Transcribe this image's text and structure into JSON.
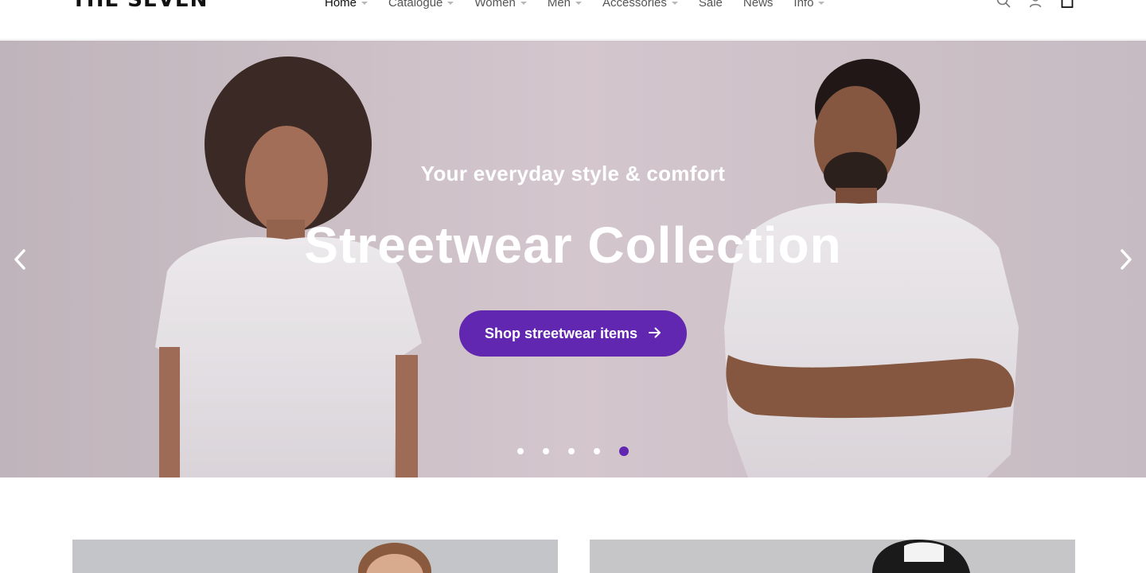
{
  "header": {
    "logo": "THE SEVEN",
    "nav": [
      {
        "label": "Home",
        "has_dropdown": true,
        "active": true
      },
      {
        "label": "Catalogue",
        "has_dropdown": true,
        "active": false
      },
      {
        "label": "Women",
        "has_dropdown": true,
        "active": false
      },
      {
        "label": "Men",
        "has_dropdown": true,
        "active": false
      },
      {
        "label": "Accessories",
        "has_dropdown": true,
        "active": false
      },
      {
        "label": "Sale",
        "has_dropdown": false,
        "active": false
      },
      {
        "label": "News",
        "has_dropdown": false,
        "active": false
      },
      {
        "label": "Info",
        "has_dropdown": true,
        "active": false
      }
    ],
    "icons": [
      "search-icon",
      "account-icon",
      "cart-icon"
    ]
  },
  "hero": {
    "subtitle": "Your everyday style & comfort",
    "title": "Streetwear Collection",
    "cta_label": "Shop streetwear items",
    "slides_total": 5,
    "active_slide": 5
  },
  "colors": {
    "accent": "#6227b0",
    "hero_bg": "#d8ccd1",
    "text_dark": "#111111",
    "nav_text": "#555555"
  },
  "cards": [
    {
      "image": "woman-portrait"
    },
    {
      "image": "man-with-cap-portrait"
    }
  ]
}
